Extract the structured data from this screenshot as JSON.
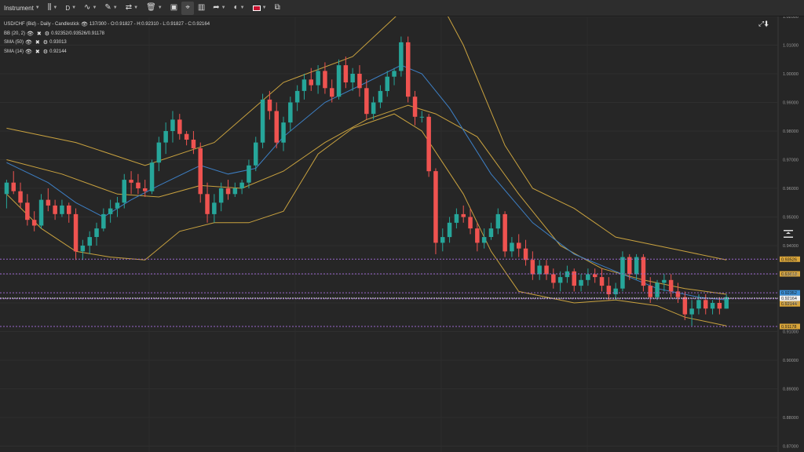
{
  "toolbar": {
    "instrument_label": "Instrument",
    "timeframe_label": "D"
  },
  "info": {
    "title": "USD/CHF (Bid) - Daily - Candlestick",
    "range": "137/300",
    "ohlc": "O:0.91827 - H:0.92310 - L:0.91827 - C:0.92164",
    "indicators": [
      {
        "name": "BB (20, 2)",
        "value": "0.92352/0.93526/0.91178"
      },
      {
        "name": "SMA (50)",
        "value": "0.93013"
      },
      {
        "name": "SMA (14)",
        "value": "0.92144"
      }
    ]
  },
  "colors": {
    "background": "#262626",
    "bull": "#26a69a",
    "bear": "#ef5350",
    "bollinger": "#c9a23f",
    "sma_fast": "#3d7fc4",
    "level_line": "#9966cc",
    "price_tag_blue": "#3a8fd6",
    "price_tag_gold": "#d9a53a"
  },
  "chart_data": {
    "type": "candlestick",
    "title": "USD/CHF (Bid) - Daily - Candlestick",
    "ylim": [
      0.87,
      1.02
    ],
    "y_ticks": [
      1.02,
      1.01,
      1.0,
      0.99,
      0.98,
      0.97,
      0.96,
      0.95,
      0.94,
      0.93,
      0.92,
      0.91,
      0.9,
      0.89,
      0.88,
      0.87
    ],
    "y_tick_labels": [
      "1.02000",
      "1.01000",
      "1.00000",
      "0.99000",
      "0.98000",
      "0.97000",
      "0.96000",
      "0.95000",
      "0.94000",
      "0.93000",
      "0.92000",
      "0.91000",
      "0.90000",
      "0.89000",
      "0.88000",
      "0.87000"
    ],
    "grid": true,
    "candles": [
      {
        "o": 0.958,
        "h": 0.963,
        "l": 0.953,
        "c": 0.962
      },
      {
        "o": 0.962,
        "h": 0.966,
        "l": 0.958,
        "c": 0.959
      },
      {
        "o": 0.959,
        "h": 0.962,
        "l": 0.953,
        "c": 0.955
      },
      {
        "o": 0.955,
        "h": 0.958,
        "l": 0.947,
        "c": 0.949
      },
      {
        "o": 0.949,
        "h": 0.952,
        "l": 0.945,
        "c": 0.947
      },
      {
        "o": 0.947,
        "h": 0.958,
        "l": 0.946,
        "c": 0.956
      },
      {
        "o": 0.956,
        "h": 0.96,
        "l": 0.952,
        "c": 0.954
      },
      {
        "o": 0.954,
        "h": 0.956,
        "l": 0.949,
        "c": 0.951
      },
      {
        "o": 0.951,
        "h": 0.956,
        "l": 0.95,
        "c": 0.954
      },
      {
        "o": 0.954,
        "h": 0.955,
        "l": 0.948,
        "c": 0.951
      },
      {
        "o": 0.951,
        "h": 0.953,
        "l": 0.935,
        "c": 0.938
      },
      {
        "o": 0.938,
        "h": 0.942,
        "l": 0.935,
        "c": 0.94
      },
      {
        "o": 0.94,
        "h": 0.945,
        "l": 0.937,
        "c": 0.943
      },
      {
        "o": 0.943,
        "h": 0.948,
        "l": 0.94,
        "c": 0.946
      },
      {
        "o": 0.946,
        "h": 0.953,
        "l": 0.945,
        "c": 0.951
      },
      {
        "o": 0.951,
        "h": 0.956,
        "l": 0.948,
        "c": 0.953
      },
      {
        "o": 0.953,
        "h": 0.957,
        "l": 0.95,
        "c": 0.955
      },
      {
        "o": 0.955,
        "h": 0.965,
        "l": 0.953,
        "c": 0.963
      },
      {
        "o": 0.963,
        "h": 0.966,
        "l": 0.958,
        "c": 0.962
      },
      {
        "o": 0.962,
        "h": 0.965,
        "l": 0.958,
        "c": 0.96
      },
      {
        "o": 0.96,
        "h": 0.963,
        "l": 0.957,
        "c": 0.959
      },
      {
        "o": 0.959,
        "h": 0.97,
        "l": 0.958,
        "c": 0.969
      },
      {
        "o": 0.969,
        "h": 0.978,
        "l": 0.966,
        "c": 0.976
      },
      {
        "o": 0.976,
        "h": 0.983,
        "l": 0.972,
        "c": 0.98
      },
      {
        "o": 0.98,
        "h": 0.987,
        "l": 0.976,
        "c": 0.984
      },
      {
        "o": 0.984,
        "h": 0.986,
        "l": 0.977,
        "c": 0.979
      },
      {
        "o": 0.979,
        "h": 0.98,
        "l": 0.975,
        "c": 0.977
      },
      {
        "o": 0.977,
        "h": 0.98,
        "l": 0.972,
        "c": 0.974
      },
      {
        "o": 0.974,
        "h": 0.976,
        "l": 0.955,
        "c": 0.958
      },
      {
        "o": 0.958,
        "h": 0.962,
        "l": 0.948,
        "c": 0.951
      },
      {
        "o": 0.951,
        "h": 0.958,
        "l": 0.948,
        "c": 0.955
      },
      {
        "o": 0.955,
        "h": 0.962,
        "l": 0.952,
        "c": 0.96
      },
      {
        "o": 0.96,
        "h": 0.963,
        "l": 0.956,
        "c": 0.958
      },
      {
        "o": 0.958,
        "h": 0.962,
        "l": 0.957,
        "c": 0.96
      },
      {
        "o": 0.96,
        "h": 0.963,
        "l": 0.958,
        "c": 0.962
      },
      {
        "o": 0.962,
        "h": 0.97,
        "l": 0.96,
        "c": 0.968
      },
      {
        "o": 0.968,
        "h": 0.978,
        "l": 0.966,
        "c": 0.976
      },
      {
        "o": 0.976,
        "h": 0.993,
        "l": 0.974,
        "c": 0.991
      },
      {
        "o": 0.991,
        "h": 0.994,
        "l": 0.984,
        "c": 0.987
      },
      {
        "o": 0.987,
        "h": 0.99,
        "l": 0.974,
        "c": 0.976
      },
      {
        "o": 0.976,
        "h": 0.985,
        "l": 0.973,
        "c": 0.983
      },
      {
        "o": 0.983,
        "h": 0.992,
        "l": 0.98,
        "c": 0.99
      },
      {
        "o": 0.99,
        "h": 0.996,
        "l": 0.987,
        "c": 0.994
      },
      {
        "o": 0.994,
        "h": 1.0,
        "l": 0.991,
        "c": 0.998
      },
      {
        "o": 0.998,
        "h": 1.002,
        "l": 0.994,
        "c": 0.996
      },
      {
        "o": 0.996,
        "h": 1.003,
        "l": 0.993,
        "c": 1.001
      },
      {
        "o": 1.001,
        "h": 1.004,
        "l": 0.993,
        "c": 0.995
      },
      {
        "o": 0.995,
        "h": 0.998,
        "l": 0.99,
        "c": 0.992
      },
      {
        "o": 0.992,
        "h": 1.005,
        "l": 0.991,
        "c": 1.003
      },
      {
        "o": 1.003,
        "h": 1.006,
        "l": 0.995,
        "c": 0.997
      },
      {
        "o": 0.997,
        "h": 1.002,
        "l": 0.994,
        "c": 1.0
      },
      {
        "o": 1.0,
        "h": 1.003,
        "l": 0.992,
        "c": 0.995
      },
      {
        "o": 0.995,
        "h": 0.998,
        "l": 0.984,
        "c": 0.986
      },
      {
        "o": 0.986,
        "h": 0.992,
        "l": 0.984,
        "c": 0.99
      },
      {
        "o": 0.99,
        "h": 0.996,
        "l": 0.988,
        "c": 0.994
      },
      {
        "o": 0.994,
        "h": 1.001,
        "l": 0.992,
        "c": 0.999
      },
      {
        "o": 0.999,
        "h": 1.002,
        "l": 0.996,
        "c": 1.001
      },
      {
        "o": 1.001,
        "h": 1.013,
        "l": 0.999,
        "c": 1.011
      },
      {
        "o": 1.011,
        "h": 1.013,
        "l": 0.99,
        "c": 0.992
      },
      {
        "o": 0.992,
        "h": 0.994,
        "l": 0.982,
        "c": 0.985
      },
      {
        "o": 0.985,
        "h": 0.987,
        "l": 0.983,
        "c": 0.985
      },
      {
        "o": 0.985,
        "h": 0.986,
        "l": 0.964,
        "c": 0.966
      },
      {
        "o": 0.966,
        "h": 0.967,
        "l": 0.937,
        "c": 0.941
      },
      {
        "o": 0.941,
        "h": 0.946,
        "l": 0.938,
        "c": 0.943
      },
      {
        "o": 0.943,
        "h": 0.95,
        "l": 0.941,
        "c": 0.948
      },
      {
        "o": 0.948,
        "h": 0.953,
        "l": 0.946,
        "c": 0.951
      },
      {
        "o": 0.951,
        "h": 0.954,
        "l": 0.948,
        "c": 0.95
      },
      {
        "o": 0.95,
        "h": 0.953,
        "l": 0.944,
        "c": 0.946
      },
      {
        "o": 0.946,
        "h": 0.948,
        "l": 0.938,
        "c": 0.941
      },
      {
        "o": 0.941,
        "h": 0.946,
        "l": 0.939,
        "c": 0.943
      },
      {
        "o": 0.943,
        "h": 0.948,
        "l": 0.942,
        "c": 0.946
      },
      {
        "o": 0.946,
        "h": 0.953,
        "l": 0.944,
        "c": 0.951
      },
      {
        "o": 0.951,
        "h": 0.952,
        "l": 0.936,
        "c": 0.938
      },
      {
        "o": 0.938,
        "h": 0.943,
        "l": 0.936,
        "c": 0.941
      },
      {
        "o": 0.941,
        "h": 0.944,
        "l": 0.936,
        "c": 0.939
      },
      {
        "o": 0.939,
        "h": 0.942,
        "l": 0.933,
        "c": 0.935
      },
      {
        "o": 0.935,
        "h": 0.938,
        "l": 0.928,
        "c": 0.93
      },
      {
        "o": 0.93,
        "h": 0.935,
        "l": 0.928,
        "c": 0.933
      },
      {
        "o": 0.933,
        "h": 0.935,
        "l": 0.928,
        "c": 0.93
      },
      {
        "o": 0.93,
        "h": 0.932,
        "l": 0.925,
        "c": 0.927
      },
      {
        "o": 0.927,
        "h": 0.931,
        "l": 0.924,
        "c": 0.929
      },
      {
        "o": 0.929,
        "h": 0.933,
        "l": 0.927,
        "c": 0.931
      },
      {
        "o": 0.931,
        "h": 0.932,
        "l": 0.924,
        "c": 0.926
      },
      {
        "o": 0.926,
        "h": 0.93,
        "l": 0.924,
        "c": 0.928
      },
      {
        "o": 0.928,
        "h": 0.932,
        "l": 0.926,
        "c": 0.93
      },
      {
        "o": 0.93,
        "h": 0.932,
        "l": 0.927,
        "c": 0.929
      },
      {
        "o": 0.929,
        "h": 0.932,
        "l": 0.924,
        "c": 0.926
      },
      {
        "o": 0.926,
        "h": 0.929,
        "l": 0.921,
        "c": 0.923
      },
      {
        "o": 0.923,
        "h": 0.927,
        "l": 0.921,
        "c": 0.925
      },
      {
        "o": 0.925,
        "h": 0.938,
        "l": 0.924,
        "c": 0.936
      },
      {
        "o": 0.936,
        "h": 0.937,
        "l": 0.928,
        "c": 0.93
      },
      {
        "o": 0.93,
        "h": 0.937,
        "l": 0.928,
        "c": 0.936
      },
      {
        "o": 0.936,
        "h": 0.937,
        "l": 0.924,
        "c": 0.926
      },
      {
        "o": 0.926,
        "h": 0.929,
        "l": 0.92,
        "c": 0.922
      },
      {
        "o": 0.922,
        "h": 0.928,
        "l": 0.921,
        "c": 0.927
      },
      {
        "o": 0.927,
        "h": 0.93,
        "l": 0.924,
        "c": 0.928
      },
      {
        "o": 0.928,
        "h": 0.93,
        "l": 0.922,
        "c": 0.924
      },
      {
        "o": 0.924,
        "h": 0.927,
        "l": 0.92,
        "c": 0.922
      },
      {
        "o": 0.922,
        "h": 0.924,
        "l": 0.914,
        "c": 0.916
      },
      {
        "o": 0.916,
        "h": 0.921,
        "l": 0.912,
        "c": 0.918
      },
      {
        "o": 0.918,
        "h": 0.923,
        "l": 0.916,
        "c": 0.921
      },
      {
        "o": 0.921,
        "h": 0.923,
        "l": 0.916,
        "c": 0.918
      },
      {
        "o": 0.918,
        "h": 0.921,
        "l": 0.916,
        "c": 0.92
      },
      {
        "o": 0.92,
        "h": 0.922,
        "l": 0.916,
        "c": 0.918
      },
      {
        "o": 0.918,
        "h": 0.923,
        "l": 0.918,
        "c": 0.922
      }
    ],
    "bb_upper": [
      [
        0,
        0.981
      ],
      [
        10,
        0.976
      ],
      [
        20,
        0.968
      ],
      [
        30,
        0.976
      ],
      [
        40,
        0.997
      ],
      [
        50,
        1.006
      ],
      [
        58,
        1.024
      ],
      [
        62,
        1.028
      ],
      [
        66,
        1.01
      ],
      [
        72,
        0.975
      ],
      [
        76,
        0.96
      ],
      [
        82,
        0.953
      ],
      [
        88,
        0.943
      ],
      [
        94,
        0.94
      ],
      [
        98,
        0.938
      ],
      [
        104,
        0.935
      ]
    ],
    "bb_lower": [
      [
        0,
        0.958
      ],
      [
        5,
        0.946
      ],
      [
        10,
        0.938
      ],
      [
        15,
        0.936
      ],
      [
        20,
        0.935
      ],
      [
        25,
        0.945
      ],
      [
        30,
        0.948
      ],
      [
        35,
        0.948
      ],
      [
        40,
        0.952
      ],
      [
        45,
        0.972
      ],
      [
        50,
        0.981
      ],
      [
        56,
        0.986
      ],
      [
        60,
        0.98
      ],
      [
        66,
        0.958
      ],
      [
        70,
        0.938
      ],
      [
        74,
        0.924
      ],
      [
        78,
        0.922
      ],
      [
        82,
        0.92
      ],
      [
        88,
        0.921
      ],
      [
        94,
        0.919
      ],
      [
        98,
        0.915
      ],
      [
        104,
        0.912
      ]
    ],
    "bb_mid": [
      [
        0,
        0.97
      ],
      [
        8,
        0.965
      ],
      [
        16,
        0.958
      ],
      [
        22,
        0.957
      ],
      [
        28,
        0.961
      ],
      [
        34,
        0.96
      ],
      [
        40,
        0.966
      ],
      [
        46,
        0.976
      ],
      [
        52,
        0.984
      ],
      [
        58,
        0.989
      ],
      [
        62,
        0.986
      ],
      [
        68,
        0.978
      ],
      [
        74,
        0.958
      ],
      [
        80,
        0.94
      ],
      [
        86,
        0.932
      ],
      [
        92,
        0.928
      ],
      [
        98,
        0.925
      ],
      [
        104,
        0.923
      ]
    ],
    "sma_fast": [
      [
        0,
        0.969
      ],
      [
        6,
        0.962
      ],
      [
        10,
        0.955
      ],
      [
        14,
        0.95
      ],
      [
        18,
        0.956
      ],
      [
        22,
        0.961
      ],
      [
        28,
        0.968
      ],
      [
        32,
        0.965
      ],
      [
        36,
        0.967
      ],
      [
        40,
        0.978
      ],
      [
        46,
        0.99
      ],
      [
        52,
        0.997
      ],
      [
        57,
        1.003
      ],
      [
        60,
        1.0
      ],
      [
        64,
        0.988
      ],
      [
        70,
        0.965
      ],
      [
        76,
        0.948
      ],
      [
        82,
        0.937
      ],
      [
        88,
        0.931
      ],
      [
        94,
        0.925
      ],
      [
        100,
        0.922
      ],
      [
        104,
        0.921
      ]
    ],
    "levels": [
      {
        "value": "0.93526",
        "price": 0.93526,
        "color": "#d9a53a",
        "style": "dashed"
      },
      {
        "value": "0.93013",
        "price": 0.93013,
        "color": "#d9a53a",
        "style": "dashed"
      },
      {
        "value": "0.92352",
        "price": 0.92352,
        "color": "#3a8fd6",
        "style": "dashed"
      },
      {
        "value": "0.92164",
        "price": 0.92164,
        "color": "#f2f2f2",
        "style": "solid"
      },
      {
        "value": "0.92144",
        "price": 0.92144,
        "color": "#d9a53a",
        "style": "dashed"
      },
      {
        "value": "0.91178",
        "price": 0.91178,
        "color": "#d9a53a",
        "style": "dashed"
      }
    ]
  }
}
